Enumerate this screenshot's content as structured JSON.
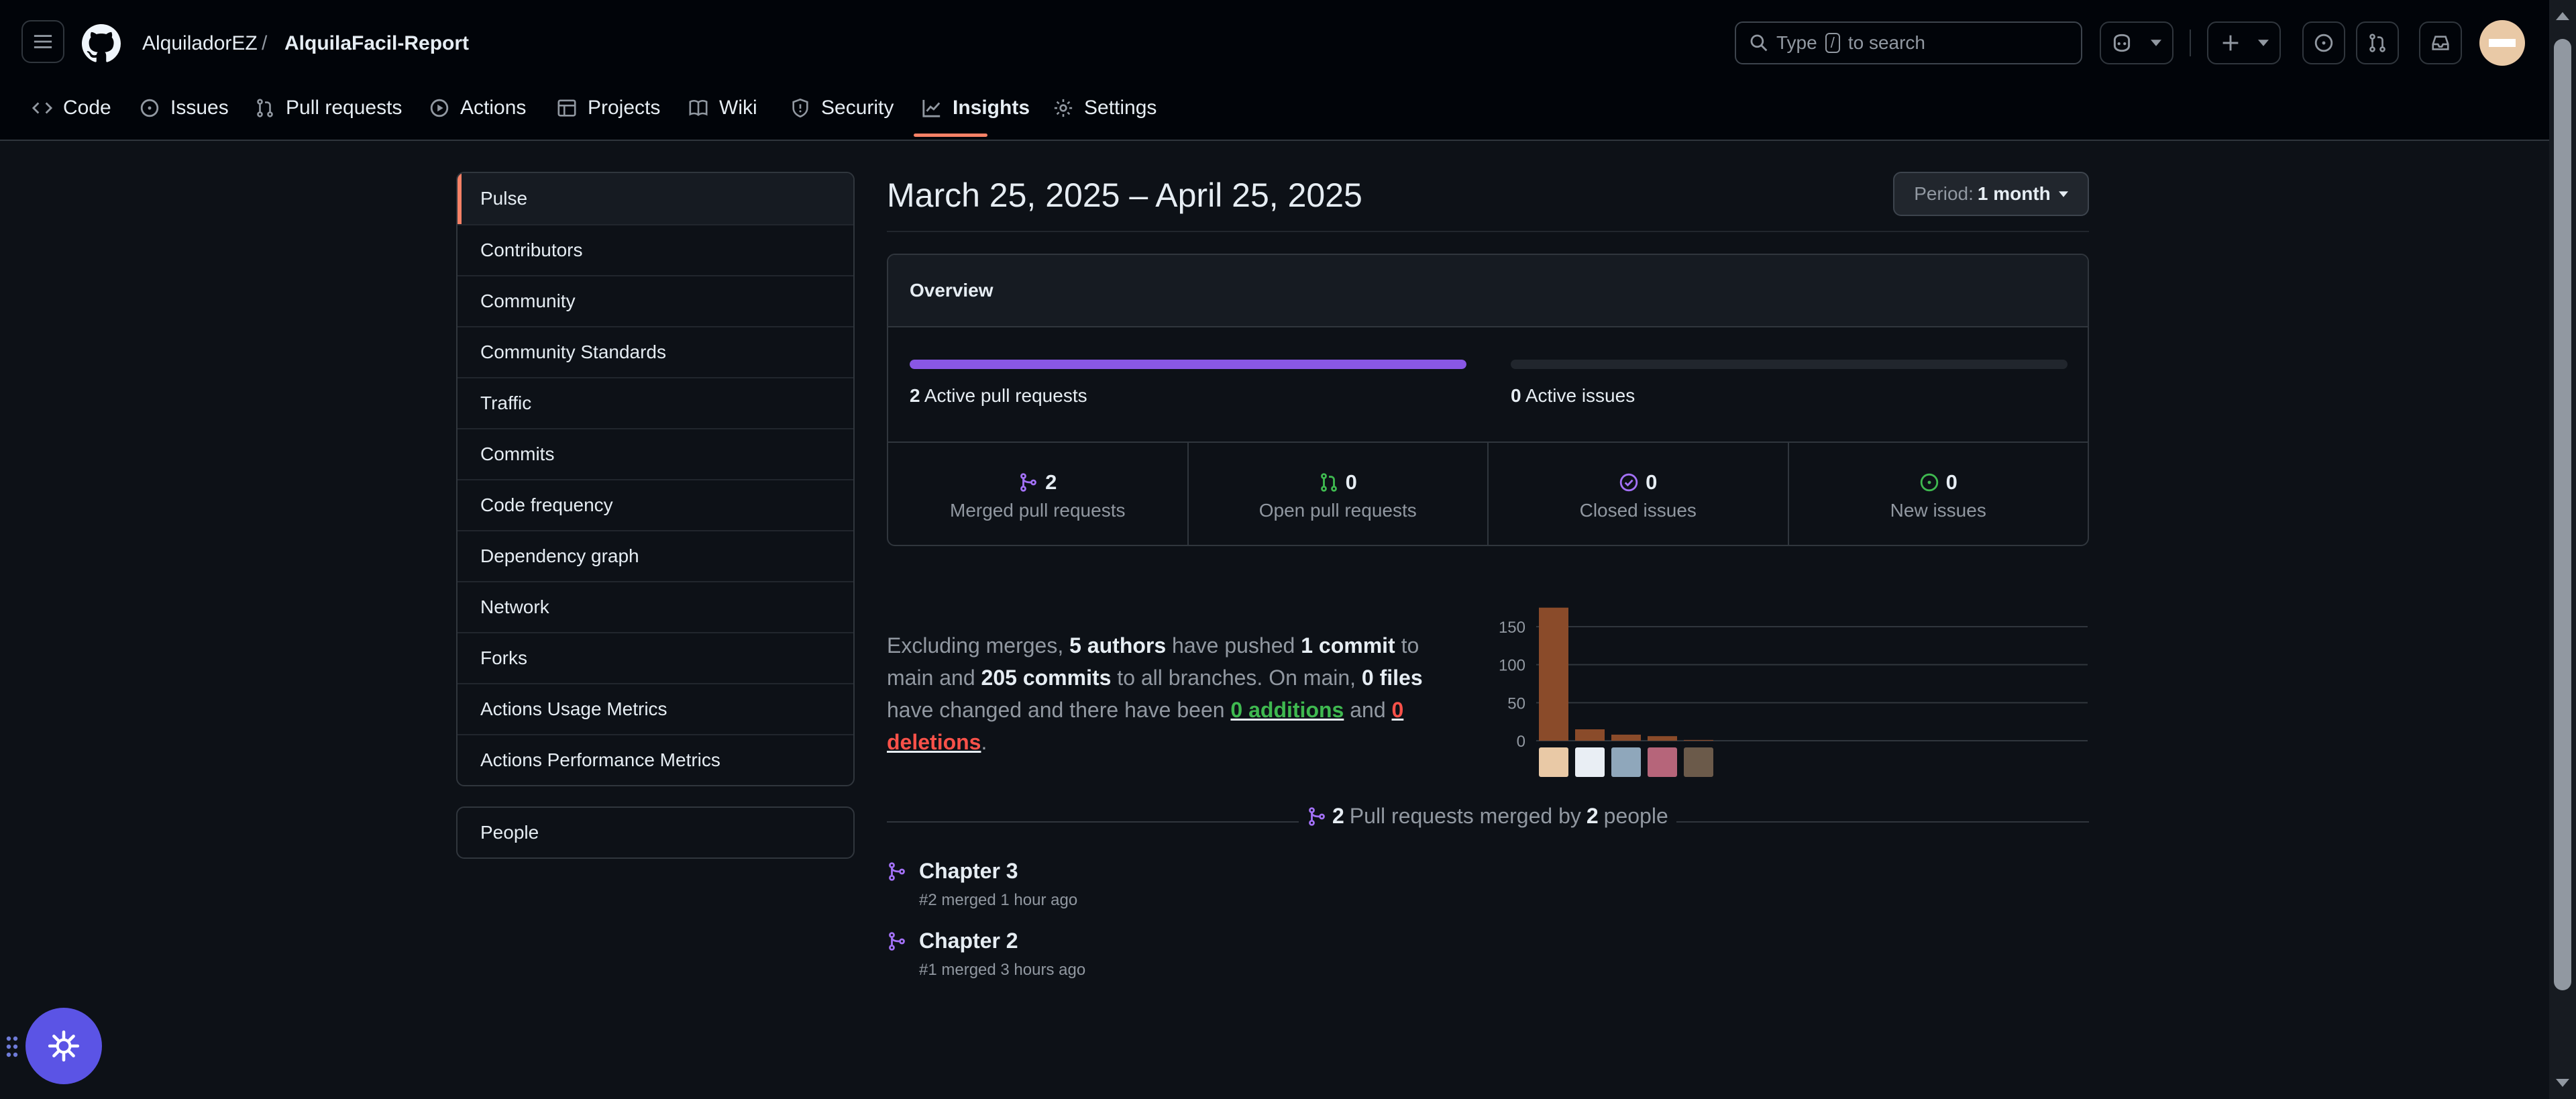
{
  "header": {
    "owner": "AlquiladorEZ",
    "separator": "/",
    "repo": "AlquilaFacil-Report",
    "search": {
      "prefix": "Type",
      "key": "/",
      "suffix": "to search"
    }
  },
  "tabs": [
    {
      "label": "Code",
      "icon": "code-icon"
    },
    {
      "label": "Issues",
      "icon": "issue-icon"
    },
    {
      "label": "Pull requests",
      "icon": "pull-request-icon"
    },
    {
      "label": "Actions",
      "icon": "play-icon"
    },
    {
      "label": "Projects",
      "icon": "table-icon"
    },
    {
      "label": "Wiki",
      "icon": "book-icon"
    },
    {
      "label": "Security",
      "icon": "shield-icon"
    },
    {
      "label": "Insights",
      "icon": "graph-icon",
      "selected": true
    },
    {
      "label": "Settings",
      "icon": "gear-icon"
    }
  ],
  "sidebar": {
    "items": [
      "Pulse",
      "Contributors",
      "Community",
      "Community Standards",
      "Traffic",
      "Commits",
      "Code frequency",
      "Dependency graph",
      "Network",
      "Forks",
      "Actions Usage Metrics",
      "Actions Performance Metrics"
    ],
    "people": "People"
  },
  "period": {
    "range": "March 25, 2025 – April 25, 2025",
    "label": "Period:",
    "value": "1 month"
  },
  "overview": {
    "title": "Overview",
    "active_prs": {
      "count": "2",
      "label": "Active pull requests",
      "fill": 1.0
    },
    "active_issues": {
      "count": "0",
      "label": "Active issues",
      "fill": 0.0
    },
    "stats": [
      {
        "value": "2",
        "label": "Merged pull requests",
        "icon": "merge-icon",
        "color": "#a371f7"
      },
      {
        "value": "0",
        "label": "Open pull requests",
        "icon": "pull-request-icon",
        "color": "#3fb950"
      },
      {
        "value": "0",
        "label": "Closed issues",
        "icon": "issue-closed-icon",
        "color": "#a371f7"
      },
      {
        "value": "0",
        "label": "New issues",
        "icon": "issue-open-icon",
        "color": "#3fb950"
      }
    ]
  },
  "summary": {
    "t1": "Excluding merges,",
    "authors": "5 authors",
    "t2": "have pushed",
    "commit": "1 commit",
    "t3": "to main and",
    "commits": "205 commits",
    "t4": "to all branches. On main,",
    "files": "0 files",
    "t5": "have changed and there have been",
    "additions": "0 additions",
    "t6": "and",
    "deletions": "0 deletions",
    "t7": "."
  },
  "chart_data": {
    "type": "bar",
    "categories": [
      "author-1",
      "author-2",
      "author-3",
      "author-4",
      "author-5"
    ],
    "values": [
      175,
      15,
      8,
      6,
      1
    ],
    "yticks": [
      0,
      50,
      100,
      150
    ],
    "ylim": [
      0,
      180
    ],
    "bar_color": "#8a4b2a",
    "avatar_colors": [
      "#e9c9a6",
      "#e9eef4",
      "#8fa7bb",
      "#b6657a",
      "#6b5a4a"
    ]
  },
  "merged": {
    "count": "2",
    "t1": "Pull requests merged by",
    "people": "2",
    "t2": "people",
    "items": [
      {
        "title": "Chapter 3",
        "meta": "#2 merged 1 hour ago"
      },
      {
        "title": "Chapter 2",
        "meta": "#1 merged 3 hours ago"
      }
    ]
  }
}
